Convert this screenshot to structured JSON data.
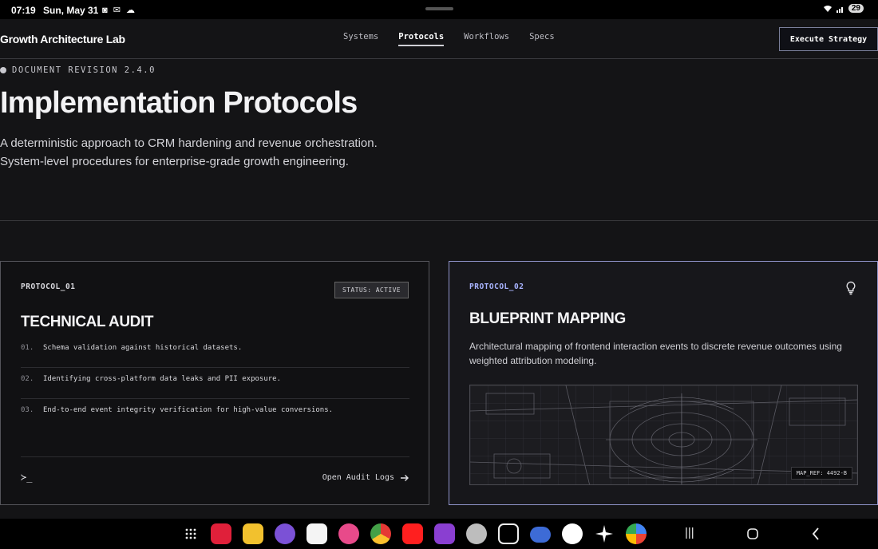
{
  "status_bar": {
    "time": "07:19",
    "date": "Sun, May 31",
    "notifications": "◙ ✉ ☁",
    "battery": "29"
  },
  "header": {
    "brand": "Growth Architecture Lab",
    "nav": [
      {
        "label": "Systems",
        "active": false
      },
      {
        "label": "Protocols",
        "active": true
      },
      {
        "label": "Workflows",
        "active": false
      },
      {
        "label": "Specs",
        "active": false
      }
    ],
    "cta_label": "Execute Strategy"
  },
  "hero": {
    "revision": "DOCUMENT REVISION 2.4.0",
    "title": "Implementation Protocols",
    "lead_line1": "A deterministic approach to CRM hardening and revenue orchestration.",
    "lead_line2": "System-level procedures for enterprise-grade growth engineering."
  },
  "cards": [
    {
      "id": "PROTOCOL_01",
      "status": "STATUS: ACTIVE",
      "title": "TECHNICAL AUDIT",
      "items": [
        {
          "num": "01.",
          "text": "Schema validation against historical datasets."
        },
        {
          "num": "02.",
          "text": "Identifying cross-platform data leaks and PII exposure."
        },
        {
          "num": "03.",
          "text": "End-to-end event integrity verification for high-value conversions."
        }
      ],
      "prompt": "≻_",
      "action_label": "Open Audit Logs"
    },
    {
      "id": "PROTOCOL_02",
      "title": "BLUEPRINT MAPPING",
      "description": "Architectural mapping of frontend interaction events to discrete revenue outcomes using weighted attribution modeling.",
      "map_ref": "MAP_REF: 4492-B"
    }
  ],
  "colors": {
    "background": "#141416",
    "accent_border": "#8f93c9",
    "accent_label": "#a9b4ff"
  },
  "taskbar_apps": [
    "app-drawer-icon",
    "flipboard-icon",
    "files-icon",
    "viber-icon",
    "gmail-icon",
    "gallery-icon",
    "chrome-icon",
    "youtube-icon",
    "apps-icon",
    "camera-icon",
    "edit-icon",
    "ai-icon",
    "sync-icon",
    "sparkle-icon",
    "gemini-icon"
  ]
}
